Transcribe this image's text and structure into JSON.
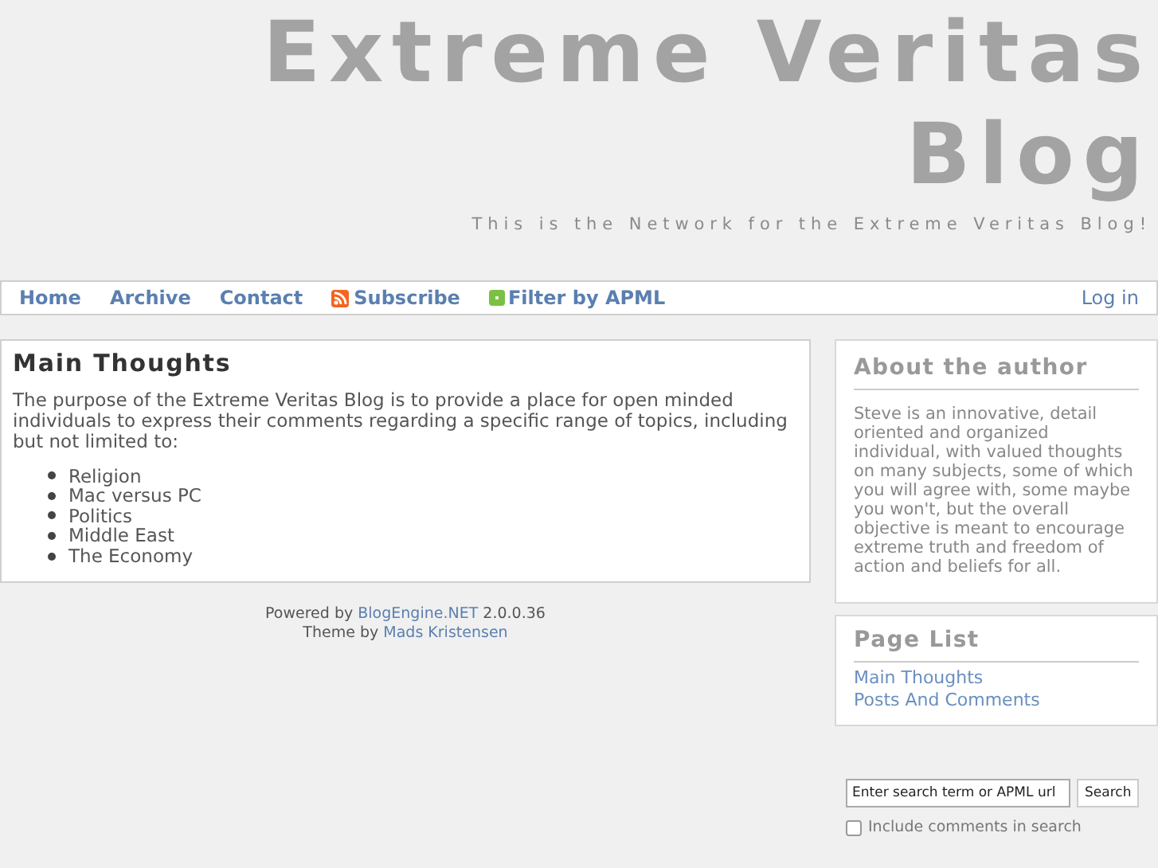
{
  "header": {
    "title": "Extreme Veritas Blog",
    "tagline": "This is the Network for the Extreme Veritas Blog!"
  },
  "nav": {
    "items": [
      {
        "label": "Home",
        "kind": "text"
      },
      {
        "label": "Archive",
        "kind": "text"
      },
      {
        "label": "Contact",
        "kind": "text"
      },
      {
        "label": "Subscribe",
        "kind": "rss"
      },
      {
        "label": "Filter by APML",
        "kind": "apml"
      }
    ],
    "login": "Log in"
  },
  "post": {
    "title": "Main Thoughts",
    "body": "The purpose of the Extreme Veritas Blog is to provide a place for open minded individuals to express their comments regarding a specific range of topics, including but not limited to:",
    "topics": [
      "Religion",
      "Mac versus PC",
      "Politics",
      "Middle East",
      "The Economy"
    ]
  },
  "footer": [
    {
      "prefix": "Powered by",
      "link": "BlogEngine.NET",
      "suffix": "2.0.0.36"
    },
    {
      "prefix": "Theme by",
      "link": "Mads Kristensen"
    }
  ],
  "about": {
    "title": "About the author",
    "text": "Steve is an innovative, detail oriented and organized individual, with valued thoughts on many subjects, some of which you will agree with, some maybe you won't, but the overall objective is meant to encourage extreme truth and freedom of action and beliefs for all."
  },
  "page_list": {
    "title": "Page List",
    "items": [
      "Main Thoughts",
      "Posts And Comments"
    ]
  },
  "search": {
    "value": "Enter search term or APML url",
    "button": "Search",
    "include_comments": {
      "label": "Include comments in search",
      "checked": false
    }
  }
}
